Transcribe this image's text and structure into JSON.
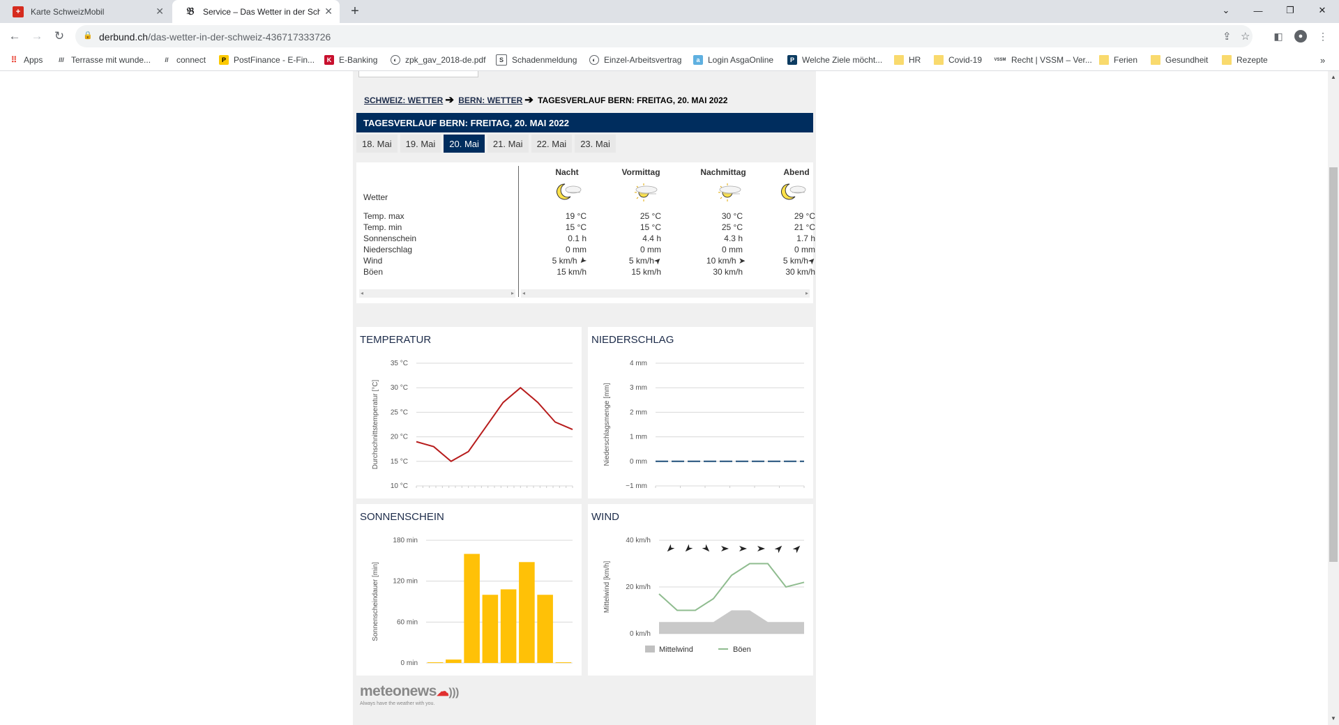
{
  "browser": {
    "tabs": [
      {
        "title": "Karte SchweizMobil",
        "active": false
      },
      {
        "title": "Service – Das Wetter in der Schweiz",
        "active": true
      }
    ],
    "url_domain": "derbund.ch",
    "url_path": "/das-wetter-in-der-schweiz-436717333726",
    "bookmarks": [
      "Apps",
      "Terrasse mit wunde...",
      "connect",
      "PostFinance - E-Fin...",
      "E-Banking",
      "zpk_gav_2018-de.pdf",
      "Schadenmeldung",
      "Einzel-Arbeitsvertrag",
      "Login AsgaOnline",
      "Welche Ziele möcht...",
      "HR",
      "Covid-19",
      "Recht | VSSM – Ver...",
      "Ferien",
      "Gesundheit",
      "Rezepte"
    ]
  },
  "breadcrumb": {
    "item1": "SCHWEIZ: WETTER",
    "item2": "BERN: WETTER",
    "current": "TAGESVERLAUF BERN: FREITAG, 20. MAI 2022"
  },
  "header": "TAGESVERLAUF BERN: FREITAG, 20. MAI 2022",
  "day_tabs": [
    "18. Mai",
    "19. Mai",
    "20. Mai",
    "21. Mai",
    "22. Mai",
    "23. Mai"
  ],
  "selected_day": 2,
  "table": {
    "row_labels": [
      "Wetter",
      "Temp. max",
      "Temp. min",
      "Sonnenschein",
      "Niederschlag",
      "Wind",
      "Böen"
    ],
    "columns": [
      {
        "name": "Nacht",
        "icon": "moon-cloud-icon",
        "tmax": "19 °C",
        "tmin": "15 °C",
        "sun": "0.1 h",
        "rain": "0 mm",
        "wind": "5 km/h",
        "gust": "15 km/h"
      },
      {
        "name": "Vormittag",
        "icon": "sun-cloud-icon",
        "tmax": "25 °C",
        "tmin": "15 °C",
        "sun": "4.4 h",
        "rain": "0 mm",
        "wind": "5 km/h",
        "gust": "15 km/h"
      },
      {
        "name": "Nachmittag",
        "icon": "sun-cloud-icon",
        "tmax": "30 °C",
        "tmin": "25 °C",
        "sun": "4.3 h",
        "rain": "0 mm",
        "wind": "10 km/h",
        "gust": "30 km/h"
      },
      {
        "name": "Abend",
        "icon": "moon-cloud-icon",
        "tmax": "29 °C",
        "tmin": "21 °C",
        "sun": "1.7 h",
        "rain": "0 mm",
        "wind": "5 km/h",
        "gust": "30 km/h"
      }
    ]
  },
  "chart_data": [
    {
      "type": "line",
      "title": "TEMPERATUR",
      "ylabel": "Durchschnittstemperatur [°C]",
      "yticks": [
        "35 °C",
        "30 °C",
        "25 °C",
        "20 °C",
        "15 °C",
        "10 °C"
      ],
      "ylim": [
        10,
        35
      ],
      "color": "#b71c1c",
      "values": [
        19,
        18,
        15,
        17,
        22,
        27,
        30,
        27,
        23,
        21.5
      ]
    },
    {
      "type": "line",
      "title": "NIEDERSCHLAG",
      "ylabel": "Niederschlagsmenge [mm]",
      "yticks": [
        "4 mm",
        "3 mm",
        "2 mm",
        "1 mm",
        "0 mm",
        "−1 mm"
      ],
      "ylim": [
        -1,
        4
      ],
      "color": "#1f4e79",
      "values": [
        0,
        0,
        0,
        0,
        0,
        0,
        0,
        0
      ]
    },
    {
      "type": "bar",
      "title": "SONNENSCHEIN",
      "ylabel": "Sonnenscheindauer [min]",
      "yticks": [
        "180 min",
        "120 min",
        "60 min",
        "0 min"
      ],
      "ylim": [
        0,
        180
      ],
      "color": "#ffc107",
      "values": [
        1,
        5,
        160,
        100,
        108,
        148,
        100,
        1
      ]
    },
    {
      "type": "area",
      "title": "WIND",
      "ylabel": "Mittelwind [km/h]",
      "yticks": [
        "40 km/h",
        "20 km/h",
        "0 km/h"
      ],
      "ylim": [
        0,
        40
      ],
      "series": [
        {
          "name": "Mittelwind",
          "color": "#c0c0c0",
          "values": [
            5,
            5,
            5,
            5,
            10,
            10,
            5,
            5,
            5
          ]
        },
        {
          "name": "Böen",
          "color": "#8fbc8f",
          "values": [
            17,
            10,
            10,
            15,
            25,
            30,
            30,
            20,
            22
          ]
        }
      ],
      "wind_dir_count": 8
    }
  ],
  "logo": {
    "name": "meteonews",
    "tagline": "Always have the weather with you."
  }
}
